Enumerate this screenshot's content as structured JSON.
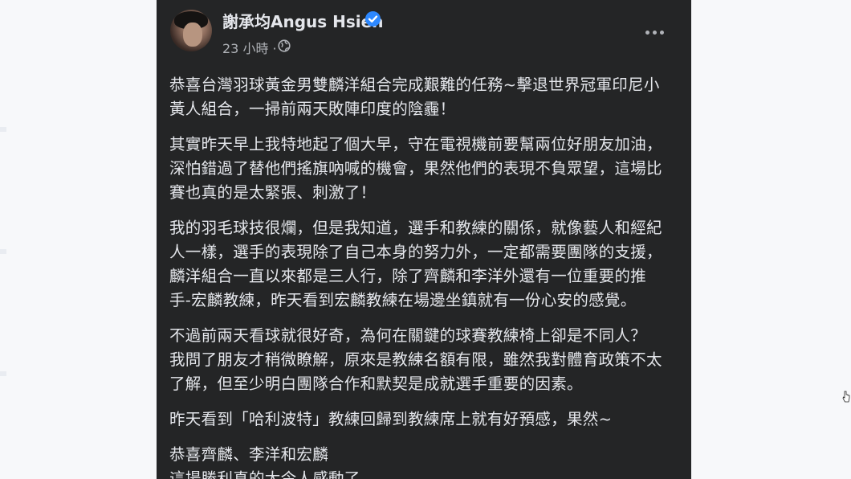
{
  "post": {
    "author": "謝承均Angus Hsieh",
    "timestamp": "23 小時 ·",
    "verified_icon": "verified-badge-icon",
    "privacy_icon": "globe-icon",
    "menu_icon": "more-options-icon",
    "paragraphs": [
      [
        "恭喜台灣羽球黃金男雙麟洋組合完成艱難的任務~擊退世界冠軍印尼小",
        "黃人組合，一掃前兩天敗陣印度的陰霾！"
      ],
      [
        "其實昨天早上我特地起了個大早，守在電視機前要幫兩位好朋友加油，",
        "深怕錯過了替他們搖旗吶喊的機會，果然他們的表現不負眾望，這場比",
        "賽也真的是太緊張、刺激了！"
      ],
      [
        "我的羽毛球技很爛，但是我知道，選手和教練的關係，就像藝人和經紀",
        "人一樣，選手的表現除了自己本身的努力外，一定都需要團隊的支援，",
        "麟洋組合一直以來都是三人行，除了齊麟和李洋外還有一位重要的推",
        "手-宏麟教練，昨天看到宏麟教練在場邊坐鎮就有一份心安的感覺。"
      ],
      [
        "不過前兩天看球就很好奇，為何在關鍵的球賽教練椅上卻是不同人？",
        "我問了朋友才稍微瞭解，原來是教練名額有限，雖然我對體育政策不太",
        "了解，但至少明白團隊合作和默契是成就選手重要的因素。"
      ],
      [
        "昨天看到「哈利波特」教練回歸到教練席上就有好預感，果然~"
      ],
      [
        "恭喜齊麟、李洋和宏麟",
        "這場勝利真的太令人感動了"
      ]
    ]
  },
  "colors": {
    "card_background": "#242526",
    "text_primary": "#e4e6eb",
    "text_secondary": "#b0b3b8",
    "verified_blue": "#2d88ff",
    "page_background": "#f7f8fa"
  }
}
